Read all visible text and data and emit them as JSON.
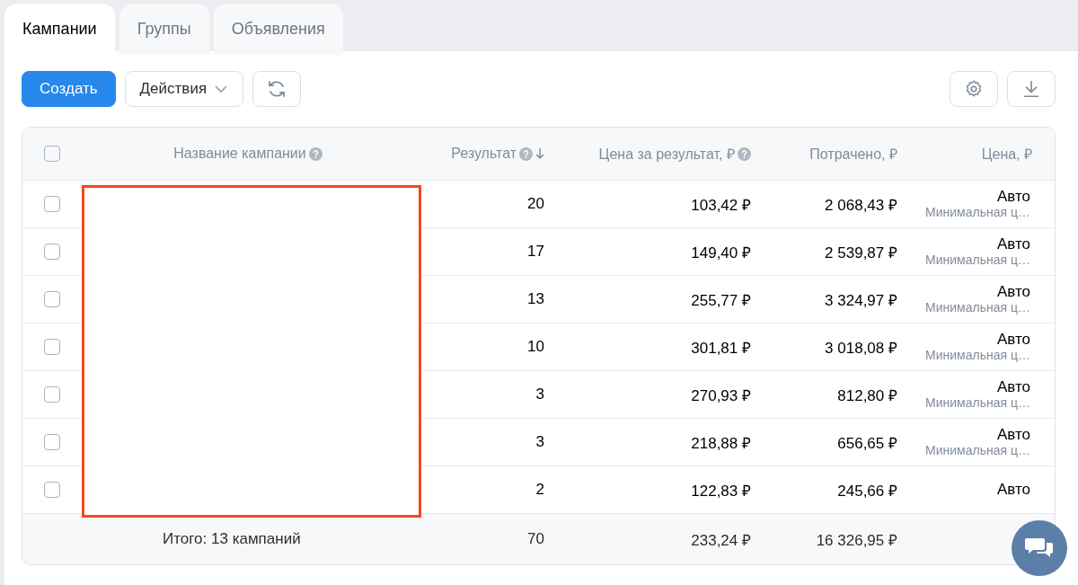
{
  "tabs": [
    {
      "label": "Кампании",
      "selected": true
    },
    {
      "label": "Группы",
      "selected": false
    },
    {
      "label": "Объявления",
      "selected": false
    }
  ],
  "toolbar": {
    "create": "Создать",
    "actions": "Действия"
  },
  "table": {
    "header_checked": false,
    "columns": [
      {
        "label": "Название кампании",
        "help": true,
        "sort": false
      },
      {
        "label": "Результат",
        "help": true,
        "sort": true
      },
      {
        "label": "Цена за результат, ₽",
        "help": true,
        "sort": false
      },
      {
        "label": "Потрачено, ₽",
        "help": false,
        "sort": false
      },
      {
        "label": "Цена, ₽",
        "help": false,
        "sort": false
      }
    ],
    "rows": [
      {
        "checked": false,
        "result": "20",
        "cost_per_result": "103,42 ₽",
        "spent": "2 068,43 ₽",
        "price": "Авто",
        "price_note": "Минимальная ц…"
      },
      {
        "checked": false,
        "result": "17",
        "cost_per_result": "149,40 ₽",
        "spent": "2 539,87 ₽",
        "price": "Авто",
        "price_note": "Минимальная ц…"
      },
      {
        "checked": false,
        "result": "13",
        "cost_per_result": "255,77 ₽",
        "spent": "3 324,97 ₽",
        "price": "Авто",
        "price_note": "Минимальная ц…"
      },
      {
        "checked": false,
        "result": "10",
        "cost_per_result": "301,81 ₽",
        "spent": "3 018,08 ₽",
        "price": "Авто",
        "price_note": "Минимальная ц…"
      },
      {
        "checked": false,
        "result": "3",
        "cost_per_result": "270,93 ₽",
        "spent": "812,80 ₽",
        "price": "Авто",
        "price_note": "Минимальная ц…"
      },
      {
        "checked": false,
        "result": "3",
        "cost_per_result": "218,88 ₽",
        "spent": "656,65 ₽",
        "price": "Авто",
        "price_note": "Минимальная ц…"
      },
      {
        "checked": false,
        "result": "2",
        "cost_per_result": "122,83 ₽",
        "spent": "245,66 ₽",
        "price": "Авто"
      }
    ],
    "footer": {
      "label": "Итого: 13 кампаний",
      "result": "70",
      "cost_per_result": "233,24 ₽",
      "spent": "16 326,95 ₽"
    }
  }
}
